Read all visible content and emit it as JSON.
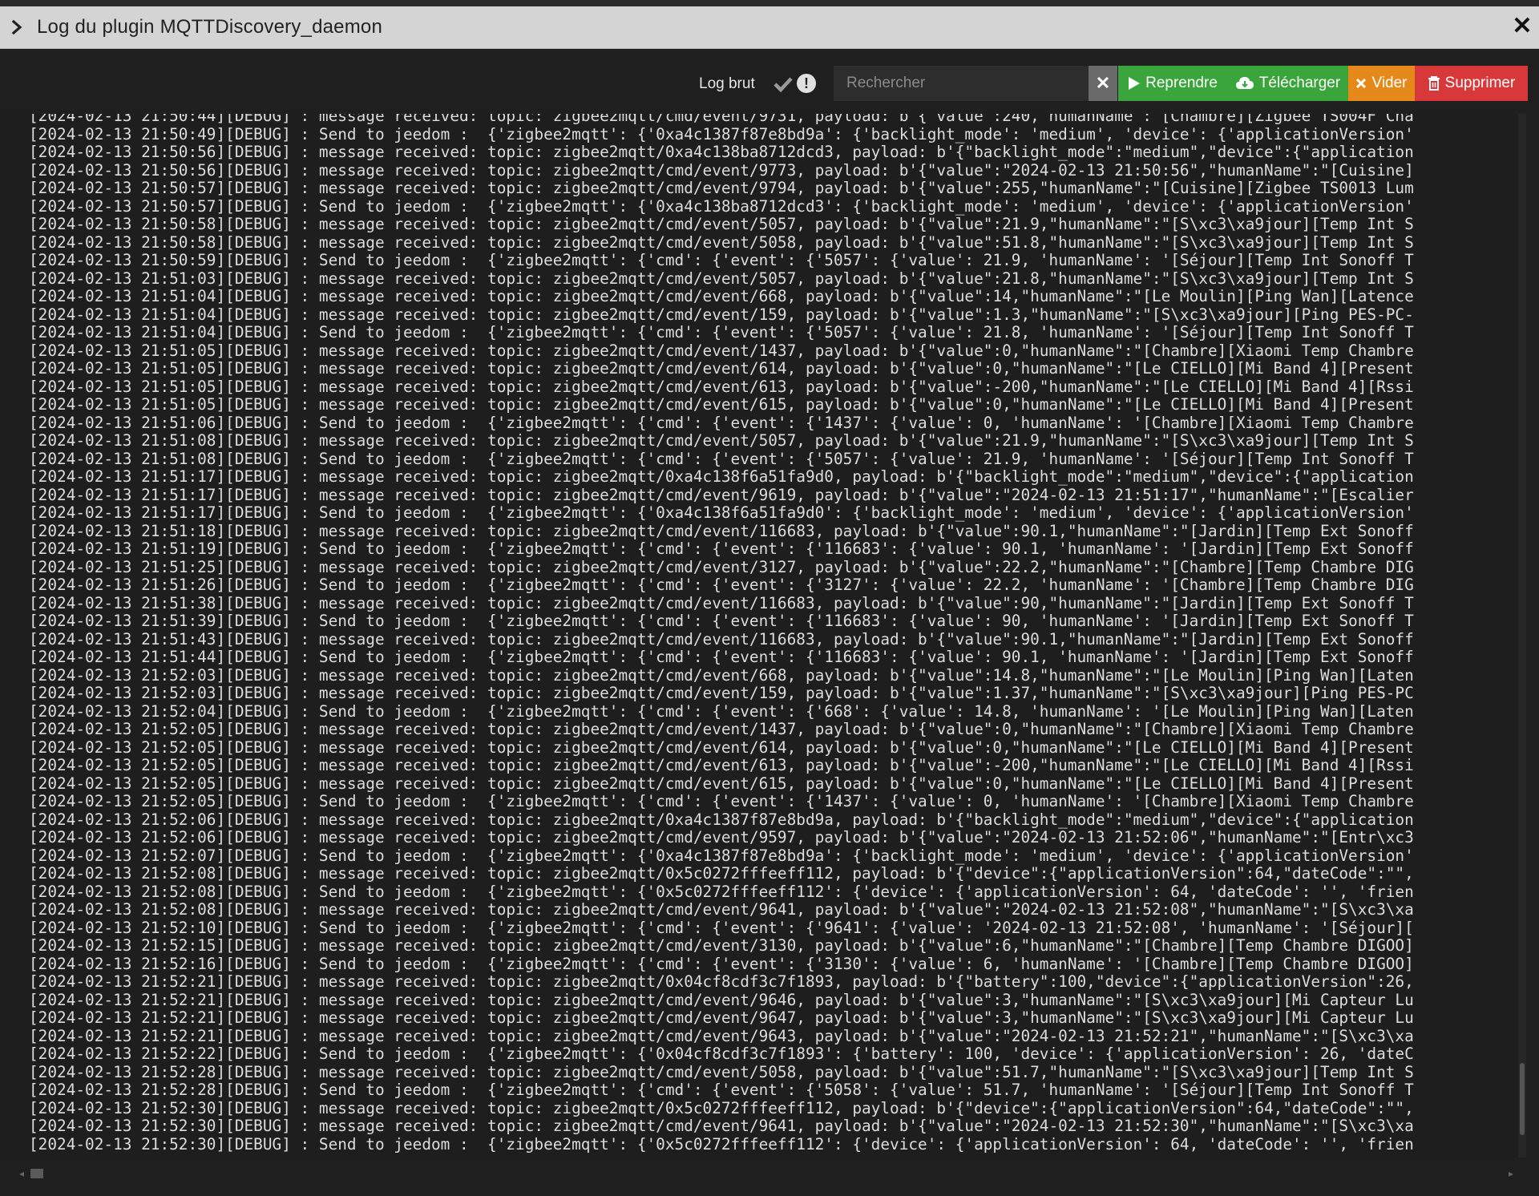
{
  "window": {
    "title": "Log du plugin MQTTDiscovery_daemon",
    "close_glyph": "✕"
  },
  "toolbar": {
    "raw_log_label": "Log brut",
    "warn_glyph": "!",
    "search_placeholder": "Rechercher",
    "search_clear_glyph": "✕",
    "btn_resume": "Reprendre",
    "btn_download": "Télécharger",
    "btn_clear": "Vider",
    "btn_delete": "Supprimer"
  },
  "colors": {
    "green": "#3aa53a",
    "orange": "#e58a1a",
    "red": "#d9383a",
    "log_bg": "#1e1e1e",
    "title_bg": "#d4d4d4"
  },
  "icons": {
    "expand": "chevron-right-icon",
    "close": "close-icon",
    "raw_check": "check-icon",
    "warning": "exclamation-circle-icon",
    "search_clear": "times-icon",
    "resume": "play-icon",
    "download": "cloud-download-icon",
    "clear": "times-icon",
    "delete": "trash-icon"
  },
  "log_lines": [
    "[2024-02-13 21:50:44][DEBUG] : message received: topic: zigbee2mqtt/cmd/event/9731, payload: b'{\"value\":240,\"humanName\":\"[Chambre][Zigbee TS004F Cha",
    "[2024-02-13 21:50:49][DEBUG] : Send to jeedom :  {'zigbee2mqtt': {'0xa4c1387f87e8bd9a': {'backlight_mode': 'medium', 'device': {'applicationVersion'",
    "[2024-02-13 21:50:56][DEBUG] : message received: topic: zigbee2mqtt/0xa4c138ba8712dcd3, payload: b'{\"backlight_mode\":\"medium\",\"device\":{\"application",
    "[2024-02-13 21:50:56][DEBUG] : message received: topic: zigbee2mqtt/cmd/event/9773, payload: b'{\"value\":\"2024-02-13 21:50:56\",\"humanName\":\"[Cuisine]",
    "[2024-02-13 21:50:57][DEBUG] : message received: topic: zigbee2mqtt/cmd/event/9794, payload: b'{\"value\":255,\"humanName\":\"[Cuisine][Zigbee TS0013 Lum",
    "[2024-02-13 21:50:57][DEBUG] : Send to jeedom :  {'zigbee2mqtt': {'0xa4c138ba8712dcd3': {'backlight_mode': 'medium', 'device': {'applicationVersion'",
    "[2024-02-13 21:50:58][DEBUG] : message received: topic: zigbee2mqtt/cmd/event/5057, payload: b'{\"value\":21.9,\"humanName\":\"[S\\xc3\\xa9jour][Temp Int S",
    "[2024-02-13 21:50:58][DEBUG] : message received: topic: zigbee2mqtt/cmd/event/5058, payload: b'{\"value\":51.8,\"humanName\":\"[S\\xc3\\xa9jour][Temp Int S",
    "[2024-02-13 21:50:59][DEBUG] : Send to jeedom :  {'zigbee2mqtt': {'cmd': {'event': {'5057': {'value': 21.9, 'humanName': '[Séjour][Temp Int Sonoff T",
    "[2024-02-13 21:51:03][DEBUG] : message received: topic: zigbee2mqtt/cmd/event/5057, payload: b'{\"value\":21.8,\"humanName\":\"[S\\xc3\\xa9jour][Temp Int S",
    "[2024-02-13 21:51:04][DEBUG] : message received: topic: zigbee2mqtt/cmd/event/668, payload: b'{\"value\":14,\"humanName\":\"[Le Moulin][Ping Wan][Latence",
    "[2024-02-13 21:51:04][DEBUG] : message received: topic: zigbee2mqtt/cmd/event/159, payload: b'{\"value\":1.3,\"humanName\":\"[S\\xc3\\xa9jour][Ping PES-PC-",
    "[2024-02-13 21:51:04][DEBUG] : Send to jeedom :  {'zigbee2mqtt': {'cmd': {'event': {'5057': {'value': 21.8, 'humanName': '[Séjour][Temp Int Sonoff T",
    "[2024-02-13 21:51:05][DEBUG] : message received: topic: zigbee2mqtt/cmd/event/1437, payload: b'{\"value\":0,\"humanName\":\"[Chambre][Xiaomi Temp Chambre",
    "[2024-02-13 21:51:05][DEBUG] : message received: topic: zigbee2mqtt/cmd/event/614, payload: b'{\"value\":0,\"humanName\":\"[Le CIELLO][Mi Band 4][Present",
    "[2024-02-13 21:51:05][DEBUG] : message received: topic: zigbee2mqtt/cmd/event/613, payload: b'{\"value\":-200,\"humanName\":\"[Le CIELLO][Mi Band 4][Rssi",
    "[2024-02-13 21:51:05][DEBUG] : message received: topic: zigbee2mqtt/cmd/event/615, payload: b'{\"value\":0,\"humanName\":\"[Le CIELLO][Mi Band 4][Present",
    "[2024-02-13 21:51:06][DEBUG] : Send to jeedom :  {'zigbee2mqtt': {'cmd': {'event': {'1437': {'value': 0, 'humanName': '[Chambre][Xiaomi Temp Chambre",
    "[2024-02-13 21:51:08][DEBUG] : message received: topic: zigbee2mqtt/cmd/event/5057, payload: b'{\"value\":21.9,\"humanName\":\"[S\\xc3\\xa9jour][Temp Int S",
    "[2024-02-13 21:51:08][DEBUG] : Send to jeedom :  {'zigbee2mqtt': {'cmd': {'event': {'5057': {'value': 21.9, 'humanName': '[Séjour][Temp Int Sonoff T",
    "[2024-02-13 21:51:17][DEBUG] : message received: topic: zigbee2mqtt/0xa4c138f6a51fa9d0, payload: b'{\"backlight_mode\":\"medium\",\"device\":{\"application",
    "[2024-02-13 21:51:17][DEBUG] : message received: topic: zigbee2mqtt/cmd/event/9619, payload: b'{\"value\":\"2024-02-13 21:51:17\",\"humanName\":\"[Escalier",
    "[2024-02-13 21:51:17][DEBUG] : Send to jeedom :  {'zigbee2mqtt': {'0xa4c138f6a51fa9d0': {'backlight_mode': 'medium', 'device': {'applicationVersion'",
    "[2024-02-13 21:51:18][DEBUG] : message received: topic: zigbee2mqtt/cmd/event/116683, payload: b'{\"value\":90.1,\"humanName\":\"[Jardin][Temp Ext Sonoff",
    "[2024-02-13 21:51:19][DEBUG] : Send to jeedom :  {'zigbee2mqtt': {'cmd': {'event': {'116683': {'value': 90.1, 'humanName': '[Jardin][Temp Ext Sonoff",
    "[2024-02-13 21:51:25][DEBUG] : message received: topic: zigbee2mqtt/cmd/event/3127, payload: b'{\"value\":22.2,\"humanName\":\"[Chambre][Temp Chambre DIG",
    "[2024-02-13 21:51:26][DEBUG] : Send to jeedom :  {'zigbee2mqtt': {'cmd': {'event': {'3127': {'value': 22.2, 'humanName': '[Chambre][Temp Chambre DIG",
    "[2024-02-13 21:51:38][DEBUG] : message received: topic: zigbee2mqtt/cmd/event/116683, payload: b'{\"value\":90,\"humanName\":\"[Jardin][Temp Ext Sonoff T",
    "[2024-02-13 21:51:39][DEBUG] : Send to jeedom :  {'zigbee2mqtt': {'cmd': {'event': {'116683': {'value': 90, 'humanName': '[Jardin][Temp Ext Sonoff T",
    "[2024-02-13 21:51:43][DEBUG] : message received: topic: zigbee2mqtt/cmd/event/116683, payload: b'{\"value\":90.1,\"humanName\":\"[Jardin][Temp Ext Sonoff",
    "[2024-02-13 21:51:44][DEBUG] : Send to jeedom :  {'zigbee2mqtt': {'cmd': {'event': {'116683': {'value': 90.1, 'humanName': '[Jardin][Temp Ext Sonoff",
    "[2024-02-13 21:52:03][DEBUG] : message received: topic: zigbee2mqtt/cmd/event/668, payload: b'{\"value\":14.8,\"humanName\":\"[Le Moulin][Ping Wan][Laten",
    "[2024-02-13 21:52:03][DEBUG] : message received: topic: zigbee2mqtt/cmd/event/159, payload: b'{\"value\":1.37,\"humanName\":\"[S\\xc3\\xa9jour][Ping PES-PC",
    "[2024-02-13 21:52:04][DEBUG] : Send to jeedom :  {'zigbee2mqtt': {'cmd': {'event': {'668': {'value': 14.8, 'humanName': '[Le Moulin][Ping Wan][Laten",
    "[2024-02-13 21:52:05][DEBUG] : message received: topic: zigbee2mqtt/cmd/event/1437, payload: b'{\"value\":0,\"humanName\":\"[Chambre][Xiaomi Temp Chambre",
    "[2024-02-13 21:52:05][DEBUG] : message received: topic: zigbee2mqtt/cmd/event/614, payload: b'{\"value\":0,\"humanName\":\"[Le CIELLO][Mi Band 4][Present",
    "[2024-02-13 21:52:05][DEBUG] : message received: topic: zigbee2mqtt/cmd/event/613, payload: b'{\"value\":-200,\"humanName\":\"[Le CIELLO][Mi Band 4][Rssi",
    "[2024-02-13 21:52:05][DEBUG] : message received: topic: zigbee2mqtt/cmd/event/615, payload: b'{\"value\":0,\"humanName\":\"[Le CIELLO][Mi Band 4][Present",
    "[2024-02-13 21:52:05][DEBUG] : Send to jeedom :  {'zigbee2mqtt': {'cmd': {'event': {'1437': {'value': 0, 'humanName': '[Chambre][Xiaomi Temp Chambre",
    "[2024-02-13 21:52:06][DEBUG] : message received: topic: zigbee2mqtt/0xa4c1387f87e8bd9a, payload: b'{\"backlight_mode\":\"medium\",\"device\":{\"application",
    "[2024-02-13 21:52:06][DEBUG] : message received: topic: zigbee2mqtt/cmd/event/9597, payload: b'{\"value\":\"2024-02-13 21:52:06\",\"humanName\":\"[Entr\\xc3",
    "[2024-02-13 21:52:07][DEBUG] : Send to jeedom :  {'zigbee2mqtt': {'0xa4c1387f87e8bd9a': {'backlight_mode': 'medium', 'device': {'applicationVersion'",
    "[2024-02-13 21:52:08][DEBUG] : message received: topic: zigbee2mqtt/0x5c0272fffeeff112, payload: b'{\"device\":{\"applicationVersion\":64,\"dateCode\":\"\",",
    "[2024-02-13 21:52:08][DEBUG] : Send to jeedom :  {'zigbee2mqtt': {'0x5c0272fffeeff112': {'device': {'applicationVersion': 64, 'dateCode': '', 'frien",
    "[2024-02-13 21:52:08][DEBUG] : message received: topic: zigbee2mqtt/cmd/event/9641, payload: b'{\"value\":\"2024-02-13 21:52:08\",\"humanName\":\"[S\\xc3\\xa",
    "[2024-02-13 21:52:10][DEBUG] : Send to jeedom :  {'zigbee2mqtt': {'cmd': {'event': {'9641': {'value': '2024-02-13 21:52:08', 'humanName': '[Séjour][",
    "[2024-02-13 21:52:15][DEBUG] : message received: topic: zigbee2mqtt/cmd/event/3130, payload: b'{\"value\":6,\"humanName\":\"[Chambre][Temp Chambre DIGOO]",
    "[2024-02-13 21:52:16][DEBUG] : Send to jeedom :  {'zigbee2mqtt': {'cmd': {'event': {'3130': {'value': 6, 'humanName': '[Chambre][Temp Chambre DIGOO]",
    "[2024-02-13 21:52:21][DEBUG] : message received: topic: zigbee2mqtt/0x04cf8cdf3c7f1893, payload: b'{\"battery\":100,\"device\":{\"applicationVersion\":26,",
    "[2024-02-13 21:52:21][DEBUG] : message received: topic: zigbee2mqtt/cmd/event/9646, payload: b'{\"value\":3,\"humanName\":\"[S\\xc3\\xa9jour][Mi Capteur Lu",
    "[2024-02-13 21:52:21][DEBUG] : message received: topic: zigbee2mqtt/cmd/event/9647, payload: b'{\"value\":3,\"humanName\":\"[S\\xc3\\xa9jour][Mi Capteur Lu",
    "[2024-02-13 21:52:21][DEBUG] : message received: topic: zigbee2mqtt/cmd/event/9643, payload: b'{\"value\":\"2024-02-13 21:52:21\",\"humanName\":\"[S\\xc3\\xa",
    "[2024-02-13 21:52:22][DEBUG] : Send to jeedom :  {'zigbee2mqtt': {'0x04cf8cdf3c7f1893': {'battery': 100, 'device': {'applicationVersion': 26, 'dateC",
    "[2024-02-13 21:52:28][DEBUG] : message received: topic: zigbee2mqtt/cmd/event/5058, payload: b'{\"value\":51.7,\"humanName\":\"[S\\xc3\\xa9jour][Temp Int S",
    "[2024-02-13 21:52:28][DEBUG] : Send to jeedom :  {'zigbee2mqtt': {'cmd': {'event': {'5058': {'value': 51.7, 'humanName': '[Séjour][Temp Int Sonoff T",
    "[2024-02-13 21:52:30][DEBUG] : message received: topic: zigbee2mqtt/0x5c0272fffeeff112, payload: b'{\"device\":{\"applicationVersion\":64,\"dateCode\":\"\",",
    "[2024-02-13 21:52:30][DEBUG] : message received: topic: zigbee2mqtt/cmd/event/9641, payload: b'{\"value\":\"2024-02-13 21:52:30\",\"humanName\":\"[S\\xc3\\xa",
    "[2024-02-13 21:52:30][DEBUG] : Send to jeedom :  {'zigbee2mqtt': {'0x5c0272fffeeff112': {'device': {'applicationVersion': 64, 'dateCode': '', 'frien"
  ]
}
